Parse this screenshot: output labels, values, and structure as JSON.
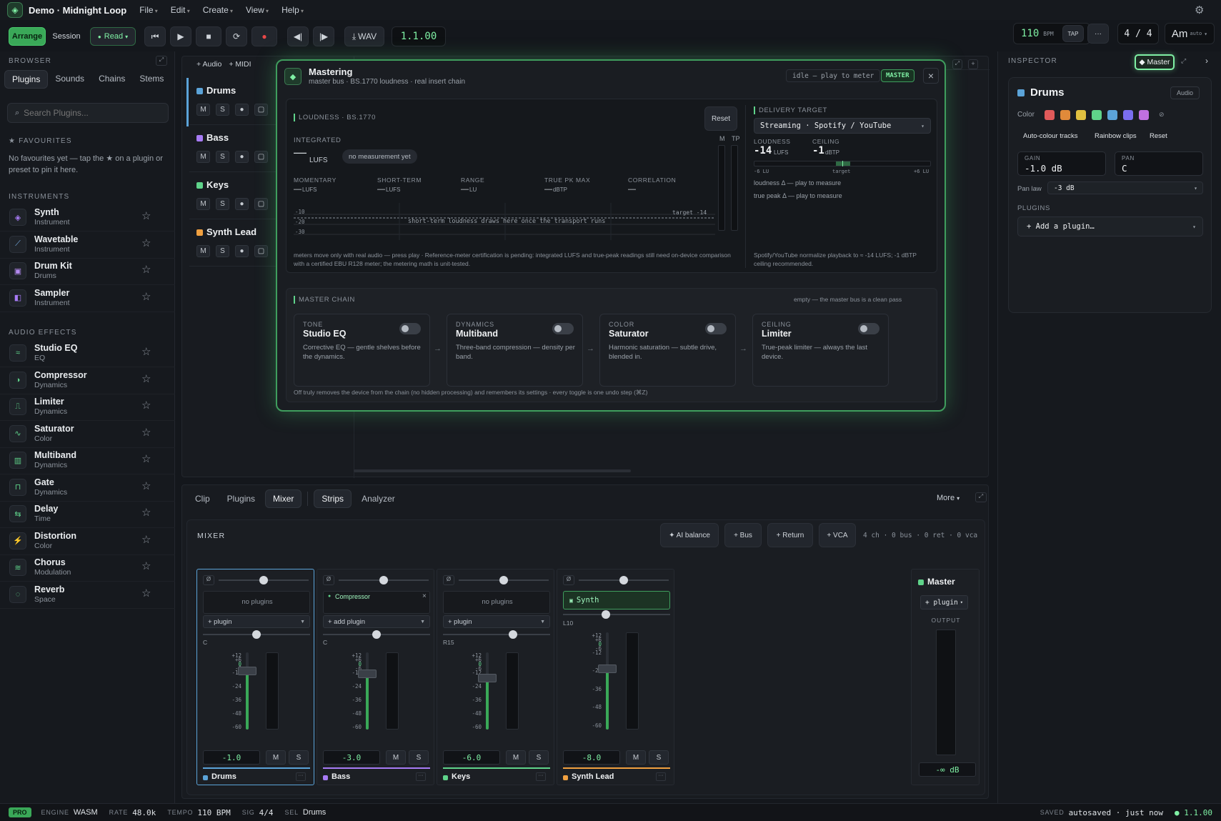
{
  "app": {
    "title": "Demo · Midnight Loop"
  },
  "menu": [
    "File",
    "Edit",
    "Create",
    "View",
    "Help"
  ],
  "transport": {
    "arrange": "Arrange",
    "session": "Session",
    "read": "Read",
    "wav": "WAV",
    "position": "1.1.00",
    "bpm": "110",
    "bpm_label": "BPM",
    "tap": "TAP",
    "more": "···",
    "signature": "4 / 4",
    "key": "Am",
    "key_mode": "auto"
  },
  "browser": {
    "label": "BROWSER",
    "tabs": [
      "Plugins",
      "Sounds",
      "Chains",
      "Stems"
    ],
    "search_placeholder": "Search Plugins...",
    "favourites_label": "★ FAVOURITES",
    "favourites_empty": "No favourites yet — tap the ★ on a plugin or preset to pin it here.",
    "instruments_label": "INSTRUMENTS",
    "instruments": [
      {
        "name": "Synth",
        "cat": "Instrument",
        "icon": "◈",
        "color": "#a77bf5"
      },
      {
        "name": "Wavetable",
        "cat": "Instrument",
        "icon": "⟋",
        "color": "#7ab0e8"
      },
      {
        "name": "Drum Kit",
        "cat": "Drums",
        "icon": "▣",
        "color": "#b48af0"
      },
      {
        "name": "Sampler",
        "cat": "Instrument",
        "icon": "◧",
        "color": "#a77bf5"
      }
    ],
    "effects_label": "AUDIO EFFECTS",
    "effects": [
      {
        "name": "Studio EQ",
        "cat": "EQ",
        "icon": "≈",
        "color": "#5fd38a"
      },
      {
        "name": "Compressor",
        "cat": "Dynamics",
        "icon": "◑",
        "color": "#5fd38a"
      },
      {
        "name": "Limiter",
        "cat": "Dynamics",
        "icon": "⎍",
        "color": "#5fd38a"
      },
      {
        "name": "Saturator",
        "cat": "Color",
        "icon": "∿",
        "color": "#5fd38a"
      },
      {
        "name": "Multiband",
        "cat": "Dynamics",
        "icon": "▥",
        "color": "#5fd38a"
      },
      {
        "name": "Gate",
        "cat": "Dynamics",
        "icon": "⊓",
        "color": "#5fd38a"
      },
      {
        "name": "Delay",
        "cat": "Time",
        "icon": "⇆",
        "color": "#5fd38a"
      },
      {
        "name": "Distortion",
        "cat": "Color",
        "icon": "⚡",
        "color": "#f0c040"
      },
      {
        "name": "Chorus",
        "cat": "Modulation",
        "icon": "≋",
        "color": "#5fd38a"
      },
      {
        "name": "Reverb",
        "cat": "Space",
        "icon": "◌",
        "color": "#5fd38a"
      }
    ]
  },
  "arrange": {
    "add_audio": "+ Audio",
    "add_midi": "+ MIDI",
    "tracks": [
      {
        "name": "Drums",
        "color": "#5ba3d8"
      },
      {
        "name": "Bass",
        "color": "#a77bf5"
      },
      {
        "name": "Keys",
        "color": "#5fd38a"
      },
      {
        "name": "Synth Lead",
        "color": "#f0a040"
      }
    ]
  },
  "mastering": {
    "title": "Mastering",
    "subtitle": "master bus · BS.1770 loudness · real insert chain",
    "status": "idle — play to meter",
    "badge": "MASTER",
    "loudness_label": "LOUDNESS · BS.1770",
    "reset": "Reset",
    "integrated_label": "INTEGRATED",
    "integrated_value": "—",
    "integrated_unit": "LUFS",
    "no_measurement": "no measurement yet",
    "meters_m": "M",
    "meters_tp": "TP",
    "stats": [
      {
        "label": "MOMENTARY",
        "value": "—",
        "unit": "LUFS"
      },
      {
        "label": "SHORT-TERM",
        "value": "—",
        "unit": "LUFS"
      },
      {
        "label": "RANGE",
        "value": "—",
        "unit": "LU"
      },
      {
        "label": "TRUE PK MAX",
        "value": "—",
        "unit": "dBTP"
      },
      {
        "label": "CORRELATION",
        "value": "—",
        "unit": ""
      }
    ],
    "graph_ticks": [
      "-10",
      "-20",
      "-30"
    ],
    "graph_target": "target -14",
    "graph_hint": "short-term loudness draws here once the transport runs",
    "footnote": "meters move only with real audio — press play · Reference-meter certification is pending: integrated LUFS and true-peak readings still need on-device comparison with a certified EBU R128 meter; the metering math is unit-tested.",
    "delivery_label": "DELIVERY TARGET",
    "delivery_select": "Streaming · Spotify / YouTube",
    "target_loudness_label": "LOUDNESS",
    "target_loudness": "-14",
    "target_loudness_unit": "LUFS",
    "ceiling_label": "CEILING",
    "ceiling": "-1",
    "ceiling_unit": "dBTP",
    "scale_left": "-6 LU",
    "scale_mid": "target",
    "scale_right": "+6 LU",
    "loudness_delta": "loudness Δ — play to measure",
    "peak_delta": "true peak Δ — play to measure",
    "delivery_note": "Spotify/YouTube normalize playback to ≈ -14 LUFS; -1 dBTP ceiling recommended.",
    "chain_label": "MASTER CHAIN",
    "chain_status": "empty — the master bus is a clean pass",
    "devices": [
      {
        "cat": "TONE",
        "name": "Studio EQ",
        "desc": "Corrective EQ — gentle shelves before the dynamics."
      },
      {
        "cat": "DYNAMICS",
        "name": "Multiband",
        "desc": "Three-band compression — density per band."
      },
      {
        "cat": "COLOR",
        "name": "Saturator",
        "desc": "Harmonic saturation — subtle drive, blended in."
      },
      {
        "cat": "CEILING",
        "name": "Limiter",
        "desc": "True-peak limiter — always the last device."
      }
    ],
    "chain_footnote": "Off truly removes the device from the chain (no hidden processing) and remembers its settings · every toggle is one undo step (⌘Z)"
  },
  "inspector": {
    "label": "INSPECTOR",
    "master_btn": "◆ Master",
    "track_name": "Drums",
    "track_type": "Audio",
    "color_label": "Color",
    "swatches": [
      "#e05a5a",
      "#e08a3a",
      "#e0c040",
      "#5fd38a",
      "#5ba3d8",
      "#7a6ef0",
      "#c070e0"
    ],
    "auto_colour": "Auto-colour tracks",
    "rainbow": "Rainbow clips",
    "reset": "Reset",
    "gain_label": "GAIN",
    "gain": "-1.0 dB",
    "pan_label": "PAN",
    "pan": "C",
    "panlaw_label": "Pan law",
    "panlaw": "-3 dB",
    "plugins_label": "PLUGINS",
    "add_plugin": "+ Add a plugin…"
  },
  "bottom": {
    "tabs": [
      "Clip",
      "Plugins",
      "Mixer"
    ],
    "subtabs": [
      "Strips",
      "Analyzer"
    ],
    "more": "More",
    "mixer_label": "MIXER",
    "ai_balance": "✦ AI balance",
    "add_bus": "+ Bus",
    "add_return": "+ Return",
    "add_vca": "+ VCA",
    "counts": "4 ch · 0 bus · 0 ret · 0 vca",
    "db_scale": [
      "+12",
      "+6",
      "0",
      "-6",
      "-12",
      "-24",
      "-36",
      "-48",
      "-60"
    ],
    "strips": [
      {
        "name": "Drums",
        "color": "#5ba3d8",
        "plugin_slot": "no plugins",
        "plugin_btn": "+ plugin",
        "pan": "C",
        "value": "-1.0",
        "fader": 0.83,
        "send": 0.5,
        "pan_pos": 0.5
      },
      {
        "name": "Bass",
        "color": "#a77bf5",
        "plugin_slot": "Compressor",
        "plugin_btn": "+ add plugin",
        "pan": "C",
        "value": "-3.0",
        "fader": 0.78,
        "send": 0.5,
        "pan_pos": 0.5
      },
      {
        "name": "Keys",
        "color": "#5fd38a",
        "plugin_slot": "no plugins",
        "plugin_btn": "+ plugin",
        "pan": "R15",
        "value": "-6.0",
        "fader": 0.72,
        "send": 0.5,
        "pan_pos": 0.65
      },
      {
        "name": "Synth Lead",
        "color": "#f0a040",
        "plugin_slot": "Synth",
        "plugin_btn": "",
        "pan": "L10",
        "value": "-8.0",
        "fader": 0.68,
        "send": 0.5,
        "pan_pos": 0.4
      }
    ],
    "master": {
      "name": "Master",
      "plugin_btn": "+ plugin",
      "output_label": "OUTPUT",
      "value": "-∞ dB"
    },
    "mute": "M",
    "solo": "S",
    "phase": "Ø"
  },
  "status": {
    "pro": "PRO",
    "engine_label": "ENGINE",
    "engine": "WASM",
    "rate_label": "RATE",
    "rate": "48.0k",
    "tempo_label": "TEMPO",
    "tempo": "110 BPM",
    "sig_label": "SIG",
    "sig": "4/4",
    "sel_label": "SEL",
    "sel": "Drums",
    "saved_label": "SAVED",
    "saved": "autosaved · just now",
    "position": "● 1.1.00"
  }
}
